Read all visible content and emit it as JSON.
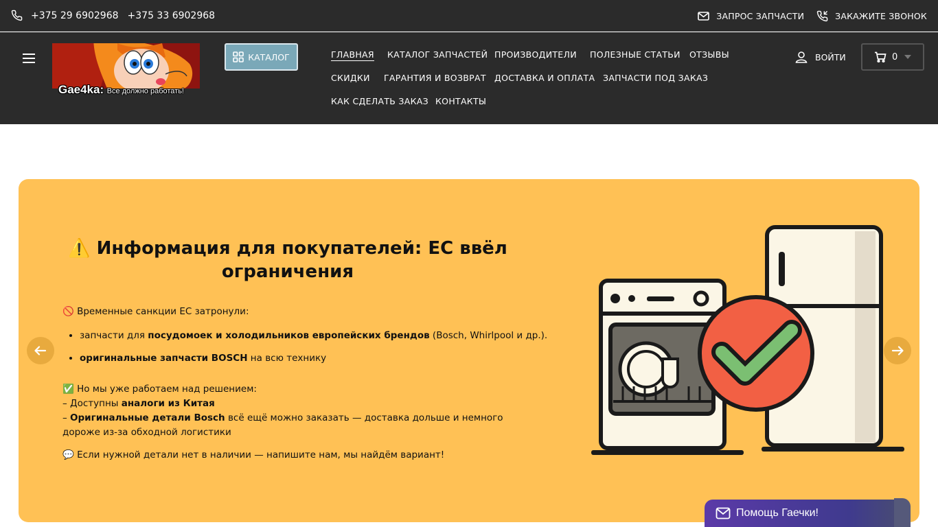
{
  "topbar": {
    "phone_icon": "phone-icon",
    "phones": [
      "+375 29 6902968",
      "+375 33 6902968"
    ],
    "request_parts_label": "ЗАПРОС ЗАПЧАСТИ",
    "request_parts_icon": "envelope-icon",
    "callback_label": "ЗАКАЖИТЕ ЗВОНОК",
    "callback_icon": "phone-incoming-icon"
  },
  "header": {
    "logo": {
      "brand": "Gae4ka:",
      "tagline": "Все должно работать!"
    },
    "catalog_button": "КАТАЛОГ",
    "nav": [
      {
        "label": "ГЛАВНАЯ",
        "active": true
      },
      {
        "label": "КАТАЛОГ ЗАПЧАСТЕЙ"
      },
      {
        "label": "ПРОИЗВОДИТЕЛИ"
      },
      {
        "label": "ПОЛЕЗНЫЕ СТАТЬИ"
      },
      {
        "label": "ОТЗЫВЫ"
      },
      {
        "label": "СКИДКИ"
      },
      {
        "label": "ГАРАНТИЯ И ВОЗВРАТ"
      },
      {
        "label": "ДОСТАВКА И ОПЛАТА"
      },
      {
        "label": "ЗАПЧАСТИ ПОД ЗАКАЗ"
      },
      {
        "label": "КАК СДЕЛАТЬ ЗАКАЗ"
      },
      {
        "label": "КОНТАКТЫ"
      }
    ],
    "login_label": "ВОЙТИ",
    "cart_count": "0"
  },
  "banner": {
    "background": "#ffc155",
    "title_line1": "⚠️ Информация для покупателей: ЕС ввёл",
    "title_line2": "ограничения",
    "sanctions_intro": "🚫 Временные санкции ЕС затронули:",
    "bullets": [
      {
        "pre": "запчасти для ",
        "bold": "посудомоек и холодильников европейских брендов",
        "post": " (Bosch, Whirlpool и др.)."
      },
      {
        "pre": "",
        "bold": "оригинальные запчасти BOSCH",
        "post": " на всю технику"
      }
    ],
    "solution_intro": "✅ Но мы уже работаем над решением:",
    "line_analog_pre": "– Доступны ",
    "line_analog_bold": "аналоги из Китая",
    "line_bosch_pre": "– ",
    "line_bosch_bold": "Оригинальные детали Bosch",
    "line_bosch_post": " всё ещё можно заказать — доставка дольше и немного",
    "line_bosch_post2": "дороже из-за обходной логистики",
    "contact_line": "💬 Если нужной детали нет в наличии — напишите нам, мы найдём вариант!"
  },
  "help_widget": {
    "label": "Помощь Гаечки!",
    "colors": [
      "#5b3aa8",
      "#3f3a8e"
    ]
  }
}
